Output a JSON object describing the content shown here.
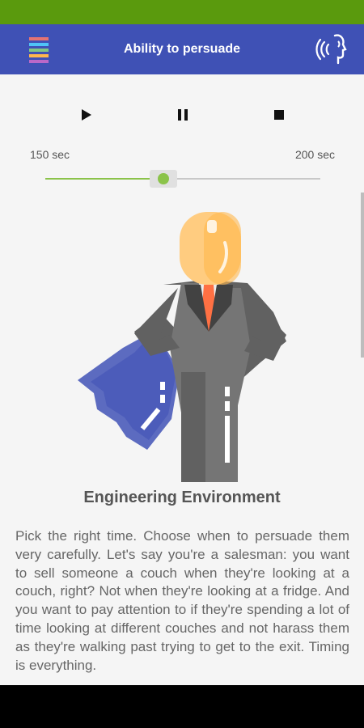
{
  "app_bar": {
    "title": "Ability to persuade",
    "menu_icon": "menu-lines-icon",
    "voice_icon": "speaking-head-icon",
    "color": "#3f51b5"
  },
  "status_bar": {
    "color": "#5a9a0d"
  },
  "player": {
    "play_icon": "play-icon",
    "pause_icon": "pause-icon",
    "stop_icon": "stop-icon",
    "time_start": "150 sec",
    "time_end": "200 sec",
    "slider_position_fraction": 0.43,
    "accent_color": "#8bc34a"
  },
  "article": {
    "image_icon": "superhero-businessman-icon",
    "image_title": "Engineering Environment",
    "text": "Pick the right time. Choose when to persuade them very carefully. Let's say you're a salesman: you want to sell someone a couch when they're looking at a couch, right? Not when they're looking at a fridge. And you want to pay attention to if they're spending a lot of time looking at different couches and not harass them as they're walking past trying to get to the exit. Timing is everything."
  }
}
